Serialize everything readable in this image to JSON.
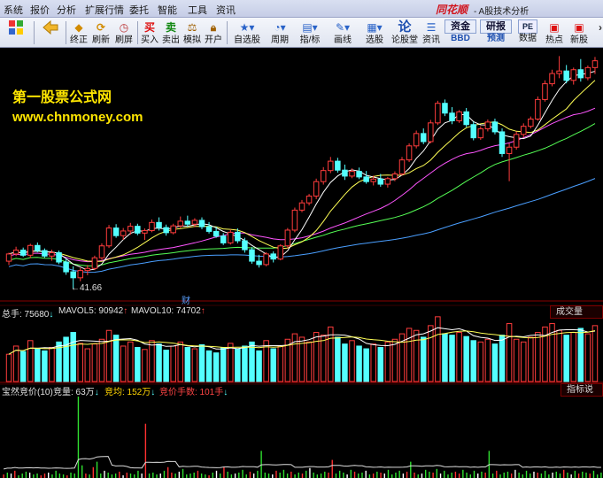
{
  "menu": {
    "items": [
      "系统",
      "报价",
      "分析",
      "扩展行情",
      "委托",
      "智能",
      "工具",
      "资讯"
    ],
    "brand": "同花顺",
    "app_title": "- A股技术分析"
  },
  "toolbar": {
    "buttons": [
      {
        "icon": "grid-icon",
        "label": ""
      },
      {
        "icon": "back-arrow-icon",
        "label": ""
      },
      {
        "icon": "prev-icon",
        "label": "终正"
      },
      {
        "icon": "refresh-icon",
        "label": "刷新"
      },
      {
        "icon": "clock-icon",
        "label": "刷屏"
      },
      {
        "icon": "buy-icon",
        "glyph": "买",
        "label": "买入"
      },
      {
        "icon": "sell-icon",
        "glyph": "卖",
        "label": "卖出"
      },
      {
        "icon": "simulate-icon",
        "label": "模拟"
      },
      {
        "icon": "lock-icon",
        "label": "开户"
      },
      {
        "icon": "star-icon",
        "label": "自选股"
      },
      {
        "icon": "period-clock-icon",
        "label": "周期"
      },
      {
        "icon": "indicator-icon",
        "label": "指/标"
      },
      {
        "icon": "draw-pen-icon",
        "label": "画线"
      },
      {
        "icon": "select-stock-icon",
        "label": "选股"
      },
      {
        "icon": "forum-icon",
        "glyph": "论",
        "label": "论股堂"
      },
      {
        "icon": "news-icon",
        "label": "资讯"
      },
      {
        "icon": "fund-icon",
        "glyph": "资金",
        "label": "BBD"
      },
      {
        "icon": "research-icon",
        "glyph": "研报",
        "label": "预测"
      },
      {
        "icon": "pe-icon",
        "glyph": "PE",
        "label": "数据"
      },
      {
        "icon": "hot-icon",
        "label": "热点"
      },
      {
        "icon": "new-stock-icon",
        "label": "新股"
      }
    ]
  },
  "watermark": {
    "line1": "第一股票公式网",
    "line2": "www.chnmoney.com"
  },
  "main": {
    "low_label": "41.66",
    "finance_marker": "财"
  },
  "volume": {
    "label_total": "总手: 75680",
    "label_ma5": "MAVOL5: 90942",
    "label_ma10": "MAVOL10: 74702",
    "tab": "成交量"
  },
  "auction": {
    "label_name": "宝然竞价(10)",
    "label_vol": "竞量: 63万",
    "label_avg": "竞均: 152万",
    "label_hands": "竞价手数: 101手",
    "tab": "指标说明",
    "values": [
      4,
      6,
      5,
      8,
      3,
      5,
      7,
      6,
      4,
      5,
      3,
      5,
      6,
      4,
      8,
      5,
      4,
      3,
      6,
      5,
      90,
      14,
      5,
      4,
      12,
      18,
      5,
      8,
      6,
      4,
      5,
      7,
      3,
      6,
      5,
      4,
      8,
      5,
      60,
      5,
      6,
      4,
      5,
      8,
      12,
      6,
      5,
      7,
      10,
      4,
      5,
      6,
      8,
      5,
      4,
      3,
      6,
      8,
      5,
      12,
      7,
      4,
      5,
      6,
      9,
      4,
      7,
      5,
      8,
      30,
      6,
      5,
      4,
      8,
      6,
      9,
      5,
      7,
      4,
      6,
      5,
      8,
      11,
      6,
      4,
      5,
      7,
      6,
      20,
      5,
      8,
      6,
      4,
      9,
      7,
      5,
      6,
      8,
      4,
      5,
      7,
      6,
      5,
      9,
      4,
      6,
      8,
      5,
      7,
      18,
      6,
      4,
      5,
      9,
      7,
      6,
      10,
      5,
      8,
      4,
      6,
      7,
      5,
      9,
      6,
      4,
      8,
      5,
      7,
      6,
      30,
      5,
      8,
      4,
      6,
      7,
      5,
      9,
      6,
      4,
      8,
      5,
      7,
      6,
      5,
      8,
      4,
      6,
      7,
      5,
      9,
      6,
      4,
      8,
      5,
      7,
      6,
      5,
      8,
      4,
      6
    ]
  },
  "colors": {
    "up": "#ff3c3c",
    "down": "#54ffff",
    "ma5": "#ffffff",
    "ma10": "#ffff55",
    "ma20": "#ff55ff",
    "ma30": "#55ff55",
    "ma60": "#4a9fff"
  },
  "chart_data": {
    "type": "candlestick",
    "price_low_marker": 41.66,
    "candles": [
      [
        48.1,
        50.1,
        47.2,
        49.8
      ],
      [
        49.8,
        51.5,
        49.3,
        50.7
      ],
      [
        50.7,
        51.3,
        49.1,
        49.5
      ],
      [
        49.5,
        52.2,
        48.8,
        51.8
      ],
      [
        51.8,
        52.5,
        50.2,
        50.6
      ],
      [
        50.6,
        51.1,
        48.9,
        49.3
      ],
      [
        49.3,
        50.8,
        48.2,
        50.1
      ],
      [
        50.1,
        50.6,
        47.4,
        47.9
      ],
      [
        47.9,
        48.7,
        44.9,
        45.6
      ],
      [
        45.6,
        46.9,
        41.66,
        44.2
      ],
      [
        44.2,
        46.5,
        43.4,
        45.9
      ],
      [
        45.9,
        47.2,
        44.8,
        46.4
      ],
      [
        46.4,
        49.4,
        46,
        48.9
      ],
      [
        48.9,
        52.3,
        48.4,
        51.7
      ],
      [
        51.7,
        56.6,
        51.2,
        55.9
      ],
      [
        55.9,
        56.8,
        53.6,
        54.1
      ],
      [
        54.1,
        55.9,
        53.1,
        55.2
      ],
      [
        55.2,
        57.1,
        54.3,
        56.3
      ],
      [
        56.3,
        56.9,
        54.2,
        54.7
      ],
      [
        54.7,
        55.8,
        53.1,
        55.3
      ],
      [
        55.3,
        57.9,
        54.9,
        57.2
      ],
      [
        57.2,
        58.4,
        55.3,
        56
      ],
      [
        56,
        56.7,
        54.1,
        54.8
      ],
      [
        54.8,
        56.9,
        54.4,
        56.4
      ],
      [
        56.4,
        58.6,
        55.9,
        57.5
      ],
      [
        57.5,
        58.8,
        56.2,
        56.8
      ],
      [
        56.8,
        58.2,
        56.1,
        57.7
      ],
      [
        57.7,
        58.4,
        55.6,
        56.2
      ],
      [
        56.2,
        57.3,
        54.6,
        55.1
      ],
      [
        55.1,
        56.2,
        53.6,
        54
      ],
      [
        54,
        54.7,
        51.9,
        52.4
      ],
      [
        52.4,
        55.6,
        52,
        54.9
      ],
      [
        54.9,
        55.8,
        52.3,
        52.9
      ],
      [
        52.9,
        53.6,
        50.1,
        50.8
      ],
      [
        50.8,
        51.4,
        47.5,
        48.1
      ],
      [
        48.1,
        49.6,
        46.6,
        47.3
      ],
      [
        47.3,
        50.2,
        46.9,
        49.8
      ],
      [
        49.8,
        50.4,
        47.8,
        48.6
      ],
      [
        48.6,
        52.1,
        48.3,
        51.7
      ],
      [
        51.7,
        55.9,
        51.2,
        55.4
      ],
      [
        55.4,
        60.7,
        54.9,
        60.1
      ],
      [
        60.1,
        62.5,
        59.6,
        61.8
      ],
      [
        61.8,
        63.9,
        61.2,
        63.4
      ],
      [
        63.4,
        67.5,
        62.7,
        66.8
      ],
      [
        66.8,
        70.2,
        66.1,
        69.4
      ],
      [
        69.4,
        72.6,
        68.8,
        71.6
      ],
      [
        71.6,
        72.4,
        68.9,
        69.5
      ],
      [
        69.5,
        70.8,
        67.2,
        68.1
      ],
      [
        68.1,
        69.9,
        67.6,
        69.2
      ],
      [
        69.2,
        70.1,
        67.4,
        67.9
      ],
      [
        67.9,
        69.3,
        66.3,
        66.8
      ],
      [
        66.8,
        68.2,
        65.9,
        67.4
      ],
      [
        67.4,
        68.6,
        65.6,
        66.2
      ],
      [
        66.2,
        67.9,
        65.4,
        67.5
      ],
      [
        67.5,
        69.2,
        66.9,
        68.6
      ],
      [
        68.6,
        72.6,
        68.2,
        71.9
      ],
      [
        71.9,
        75.8,
        71.4,
        75.2
      ],
      [
        75.2,
        78.8,
        74.6,
        78.1
      ],
      [
        78.1,
        79.3,
        75.6,
        76.2
      ],
      [
        76.2,
        81.3,
        75.8,
        80.6
      ],
      [
        80.6,
        85.8,
        80.1,
        85.2
      ],
      [
        85.2,
        86.1,
        82.2,
        82.9
      ],
      [
        82.9,
        84.3,
        80.3,
        81.1
      ],
      [
        81.1,
        83.6,
        80.6,
        83.2
      ],
      [
        83.2,
        84.1,
        79.6,
        80.2
      ],
      [
        80.2,
        80.9,
        76.5,
        77.1
      ],
      [
        77.1,
        79.8,
        76.6,
        79.2
      ],
      [
        79.2,
        81.4,
        78.6,
        80.8
      ],
      [
        80.8,
        81.6,
        77.9,
        78.5
      ],
      [
        78.5,
        79.3,
        72.6,
        73.4
      ],
      [
        73.4,
        75.8,
        66.9,
        74.9
      ],
      [
        74.9,
        78.6,
        74.3,
        77.9
      ],
      [
        77.9,
        80.5,
        77.2,
        79.8
      ],
      [
        79.8,
        82.1,
        79.3,
        81.5
      ],
      [
        81.5,
        86.8,
        81.1,
        86.1
      ],
      [
        86.1,
        90.6,
        85.6,
        89.8
      ],
      [
        89.8,
        93.1,
        89.2,
        92.2
      ],
      [
        92.2,
        96.3,
        91.1,
        92.8
      ],
      [
        92.8,
        94.2,
        89.9,
        90.6
      ],
      [
        90.6,
        93.6,
        89.6,
        93.1
      ],
      [
        93.1,
        95.6,
        90.3,
        91.2
      ],
      [
        91.2,
        94.1,
        90.6,
        93.6
      ],
      [
        93.6,
        96.1,
        92.1,
        95.2
      ]
    ],
    "volume": [
      40,
      52,
      44,
      60,
      48,
      45,
      50,
      58,
      65,
      72,
      56,
      48,
      55,
      62,
      75,
      68,
      52,
      58,
      50,
      47,
      60,
      55,
      46,
      52,
      58,
      50,
      48,
      54,
      45,
      42,
      50,
      56,
      48,
      52,
      58,
      45,
      60,
      48,
      52,
      62,
      70,
      65,
      58,
      72,
      68,
      80,
      65,
      55,
      60,
      52,
      48,
      55,
      50,
      58,
      62,
      70,
      78,
      75,
      65,
      82,
      95,
      70,
      68,
      72,
      66,
      60,
      58,
      62,
      55,
      68,
      85,
      62,
      58,
      65,
      72,
      80,
      85,
      75,
      68,
      72,
      78,
      70,
      82
    ]
  }
}
